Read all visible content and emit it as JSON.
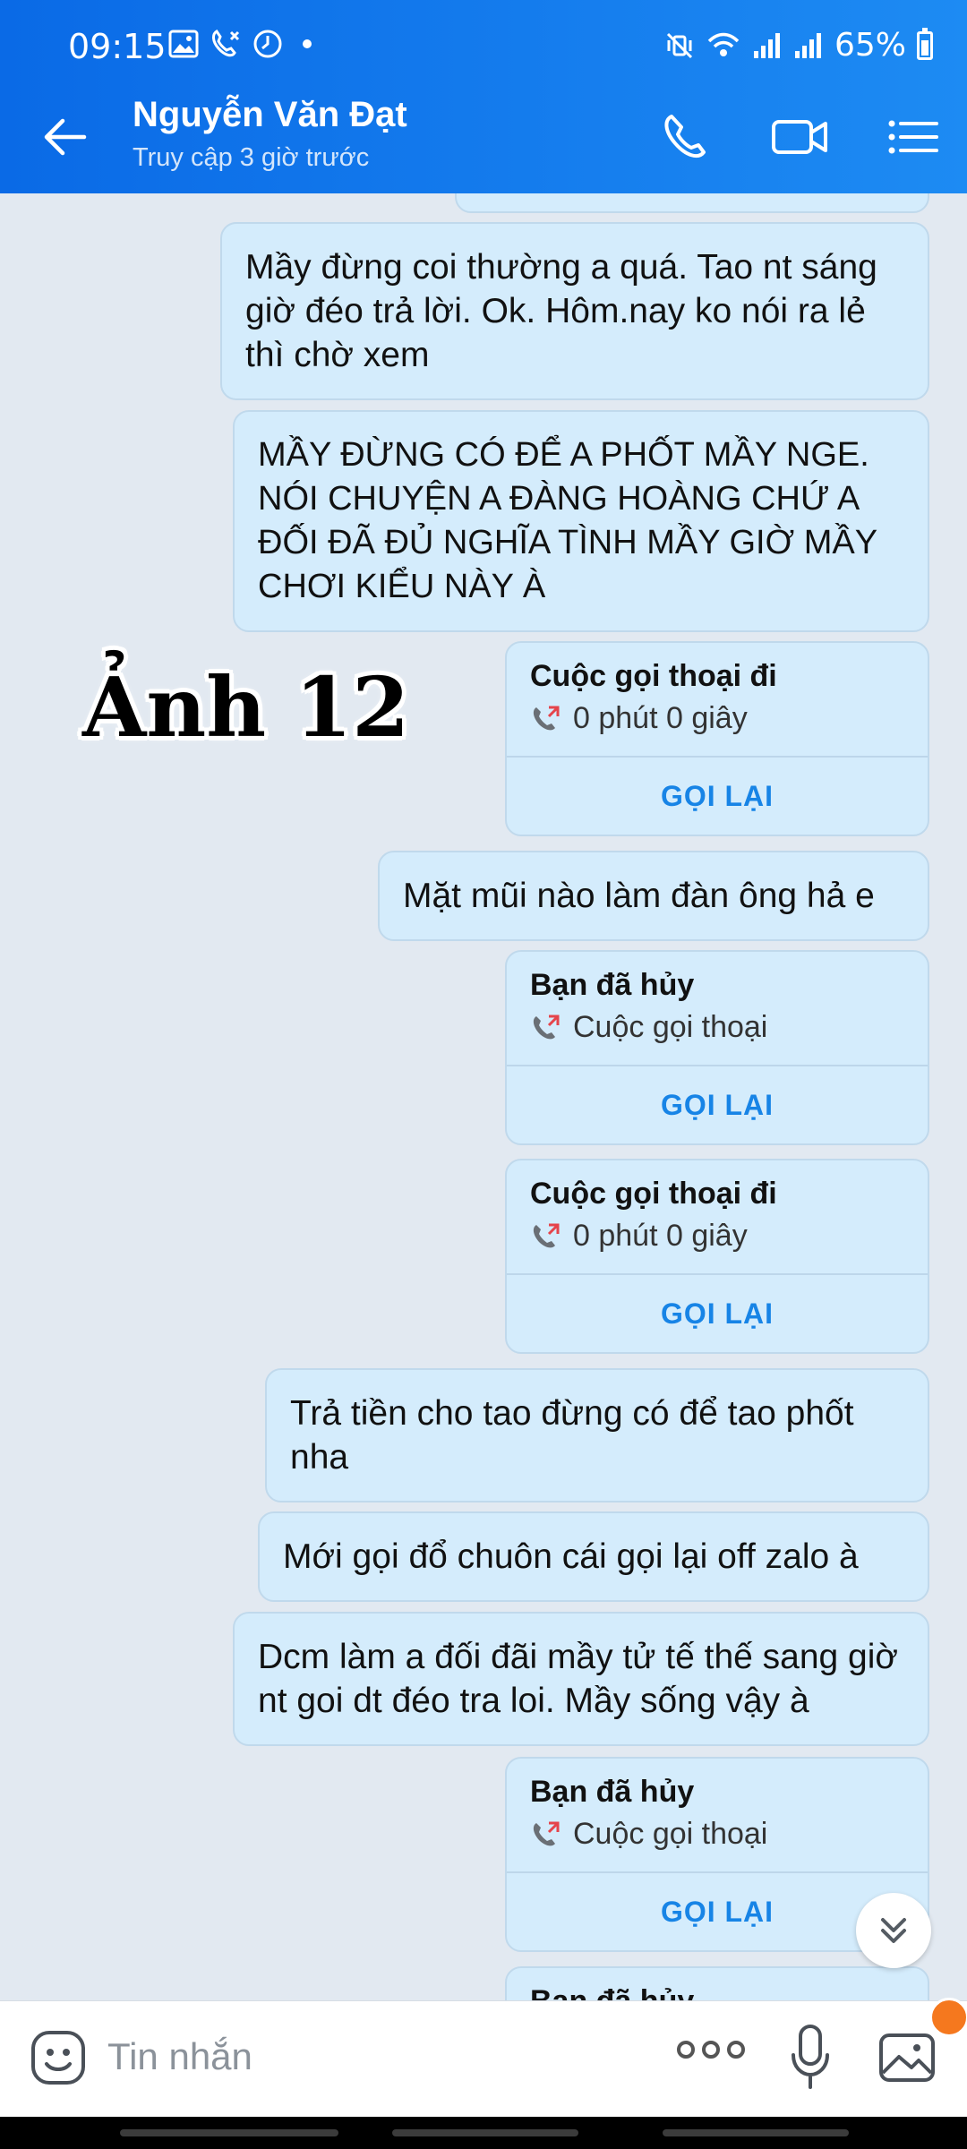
{
  "status_bar": {
    "time": "09:15",
    "battery": "65%"
  },
  "header": {
    "contact_name": "Nguyễn Văn Đạt",
    "last_seen": "Truy cập 3 giờ trước"
  },
  "watermark": "Ảnh 12",
  "messages": {
    "m1": "Mầy đừng coi thường a quá. Tao nt sáng giờ đéo trả lời. Ok. Hôm.nay ko nói ra lẻ thì chờ xem",
    "m2": "MẦY ĐỪNG CÓ ĐỂ A PHỐT MẦY NGE. NÓI CHUYỆN A ĐÀNG HOÀNG CHỨ A ĐỐI ĐÃ ĐỦ NGHĨA TÌNH MẦY GIỜ MẦY CHƠI KIỂU NÀY À",
    "m3": "Mặt mũi nào làm đàn ông hả e",
    "m4": "Trả tiền cho tao đừng có để tao phốt nha",
    "m5": "Mới gọi đổ chuôn cái gọi lại off zalo à",
    "m6": "Dcm làm a đối đãi mầy tử tế thế sang giờ nt goi dt đéo tra loi. Mầy sống vậy à"
  },
  "calls": {
    "c1": {
      "title": "Cuộc gọi thoại đi",
      "detail": "0 phút 0 giây",
      "action": "GỌI LẠI"
    },
    "c2": {
      "title": "Bạn đã hủy",
      "detail": "Cuộc gọi thoại",
      "action": "GỌI LẠI"
    },
    "c3": {
      "title": "Cuộc gọi thoại đi",
      "detail": "0 phút 0 giây",
      "action": "GỌI LẠI"
    },
    "c4": {
      "title": "Bạn đã hủy",
      "detail": "Cuộc gọi thoại",
      "action": "GỌI LẠI"
    },
    "c5": {
      "title": "Bạn đã hủy"
    }
  },
  "input": {
    "placeholder": "Tin nhắn"
  },
  "icons": {
    "back": "arrow-left-icon",
    "call": "phone-icon",
    "video": "video-camera-icon",
    "menu": "list-menu-icon",
    "sticker": "sticker-smile-icon",
    "more": "more-dots-icon",
    "mic": "microphone-icon",
    "gallery": "image-gallery-icon",
    "call_out": "outgoing-call-icon",
    "scroll_down": "double-chevron-down-icon"
  },
  "colors": {
    "header": "#1d8bf3",
    "bubble": "#d4ecfc",
    "accent": "#1784e6",
    "background": "#e2e9f1"
  }
}
